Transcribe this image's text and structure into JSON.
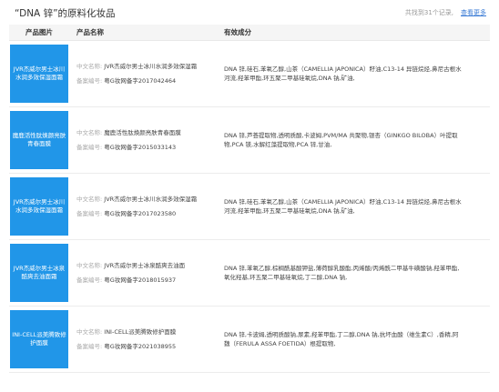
{
  "header": {
    "title": "“DNA 锌”的原料化妆品",
    "count": "共找到31个记录,",
    "more": "查看更多"
  },
  "table": {
    "columns": [
      "产品图片",
      "产品名称",
      "有效成分"
    ],
    "name_label_cn": "中文名称:",
    "name_label_reg": "备案编号:",
    "rows": [
      {
        "image_text": "JVR杰威尔男士冰川水润多效保湿面霜",
        "name_cn": "JVR杰威尔男士冰川水润多效保湿霜",
        "reg_no": "粤G妆网备字2017042464",
        "ingredients": "DNA 锌,硅石,苯氧乙醇,山茶（CAMELLIA JAPONICA）籽油,C13-14 异链烷烃,鼻尼古根水河流,羟苯甲酯,环五聚二甲基硅氧烷,DNA 钠,矿油,"
      },
      {
        "image_text": "魔鹿活性肽焕颜亮肤青春面膜",
        "name_cn": "魔鹿活性肽焕颜亮肤青春面膜",
        "reg_no": "粤G妆网备字2015033143",
        "ingredients": "DNA 锌,芦荟提取物,透明质酸,卡波姆,PVM/MA 共聚物,银杏（GINKGO BILOBA）叶提取物,PCA 镁,水解红藻提取物,PCA 锌,甘油,"
      },
      {
        "image_text": "JVR杰威尔男士冰川水润多效保湿面霜",
        "name_cn": "JVR杰威尔男士冰川水润多效保湿霜",
        "reg_no": "粤G妆网备字2017023580",
        "ingredients": "DNA 锌,硅石,苯氧乙醇,山茶（CAMELLIA JAPONICA）籽油,C13-14 异链烷烃,鼻尼古根水河流,羟苯甲酯,环五聚二甲基硅氧烷,DNA 钠,矿油,"
      },
      {
        "image_text": "JVR杰威尔男士冰泉酷爽去油面霜",
        "name_cn": "JVR杰威尔男士冰泉酷爽去油面",
        "reg_no": "粤G妆网备字2018015937",
        "ingredients": "DNA 锌,苯氧乙醇,棕榈酰基酸钾盐,薄荷醇乳酸酯,丙烯酸/丙烯酰二甲基牛磺酸钠,羟苯甲酯,氧化羟基,环五聚二甲基硅氧烷,丁二醇,DNA 钠,"
      },
      {
        "image_text": "INI-CELL派美腾致修护面膜",
        "name_cn": "INI-CELL派美腾致修护面膜",
        "reg_no": "粤G妆网备字2021038955",
        "ingredients": "DNA 锌,卡波姆,透明质酸钠,尿素,羟苯甲酯,丁二醇,DNA 钠,抗坏血酸（维生素C）,香精,阿魏（FERULA ASSA FOETIDA）根提取物,"
      }
    ]
  }
}
